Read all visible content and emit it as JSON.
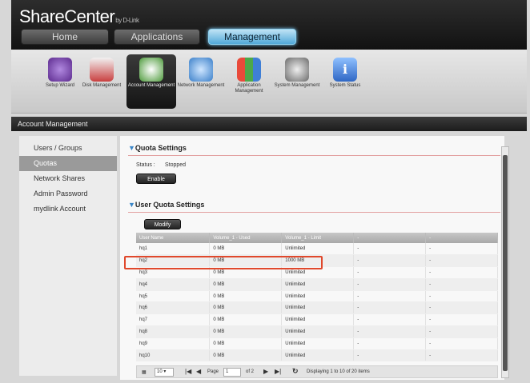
{
  "header": {
    "brand": "ShareCenter",
    "brand_sub": "by D-Link",
    "tabs": [
      {
        "label": "Home",
        "active": false
      },
      {
        "label": "Applications",
        "active": false
      },
      {
        "label": "Management",
        "active": true
      }
    ]
  },
  "toolbar": {
    "items": [
      {
        "label": "Setup Wizard",
        "icon": "wizard-icon",
        "color": "#7a4bb0"
      },
      {
        "label": "Disk Management",
        "icon": "disk-icon",
        "color": "#c94040"
      },
      {
        "label": "Account Management",
        "icon": "account-icon",
        "color": "#4c9a3a",
        "active": true
      },
      {
        "label": "Network Management",
        "icon": "network-icon",
        "color": "#3a7fc9"
      },
      {
        "label": "Application Management",
        "icon": "application-icon",
        "color": "#d08a2a"
      },
      {
        "label": "System Management",
        "icon": "system-icon",
        "color": "#6a6a6a"
      },
      {
        "label": "System Status",
        "icon": "info-icon",
        "color": "#3f7fd6"
      }
    ]
  },
  "section": {
    "title": "Account Management"
  },
  "sidebar": {
    "items": [
      {
        "label": "Users / Groups",
        "selected": false
      },
      {
        "label": "Quotas",
        "selected": true
      },
      {
        "label": "Network Shares",
        "selected": false
      },
      {
        "label": "Admin Password",
        "selected": false
      },
      {
        "label": "mydlink Account",
        "selected": false
      }
    ]
  },
  "quota_settings": {
    "title": "Quota Settings",
    "status_label": "Status :",
    "status_value": "Stopped",
    "enable_button": "Enable"
  },
  "user_quota": {
    "title": "User Quota Settings",
    "modify_button": "Modify",
    "columns": [
      "User Name",
      "Volume_1 - Used",
      "Volume_1 - Limit",
      "-",
      "-"
    ],
    "rows": [
      [
        "hq1",
        "0 MB",
        "Unlimited",
        "-",
        "-"
      ],
      [
        "hq2",
        "0 MB",
        "1000 MB",
        "-",
        "-"
      ],
      [
        "hq3",
        "0 MB",
        "Unlimited",
        "-",
        "-"
      ],
      [
        "hq4",
        "0 MB",
        "Unlimited",
        "-",
        "-"
      ],
      [
        "hq5",
        "0 MB",
        "Unlimited",
        "-",
        "-"
      ],
      [
        "hq6",
        "0 MB",
        "Unlimited",
        "-",
        "-"
      ],
      [
        "hq7",
        "0 MB",
        "Unlimited",
        "-",
        "-"
      ],
      [
        "hq8",
        "0 MB",
        "Unlimited",
        "-",
        "-"
      ],
      [
        "hq9",
        "0 MB",
        "Unlimited",
        "-",
        "-"
      ],
      [
        "hq10",
        "0 MB",
        "Unlimited",
        "-",
        "-"
      ]
    ]
  },
  "pager": {
    "page_size": "10",
    "page_label": "Page",
    "page_value": "1",
    "of_label": "of 2",
    "display_text": "Displaying 1 to 10 of 20 items"
  }
}
